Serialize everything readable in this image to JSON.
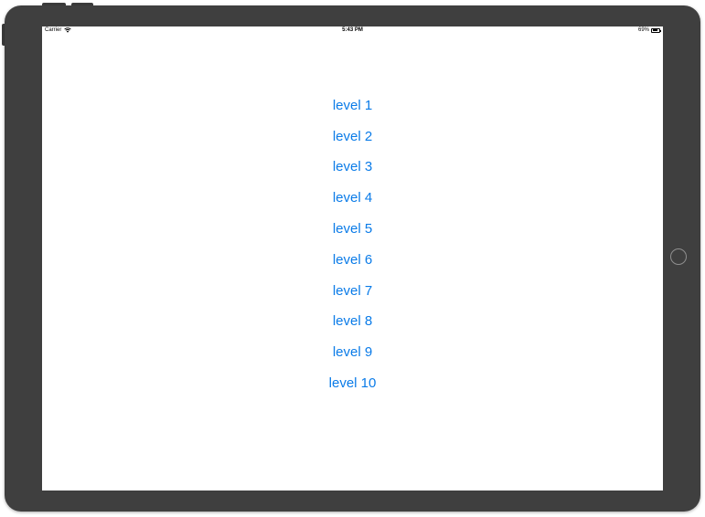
{
  "status_bar": {
    "carrier": "Carrier",
    "time": "5:43 PM",
    "battery_percent": "69%",
    "battery_level": 0.69,
    "wifi_icon": "wifi-icon"
  },
  "levels": [
    {
      "label": "level 1"
    },
    {
      "label": "level 2"
    },
    {
      "label": "level 3"
    },
    {
      "label": "level 4"
    },
    {
      "label": "level 5"
    },
    {
      "label": "level 6"
    },
    {
      "label": "level 7"
    },
    {
      "label": "level 8"
    },
    {
      "label": "level 9"
    },
    {
      "label": "level 10"
    }
  ],
  "colors": {
    "accent": "#0a7be8",
    "device_frame": "#3f3f3f",
    "screen_bg": "#ffffff"
  }
}
